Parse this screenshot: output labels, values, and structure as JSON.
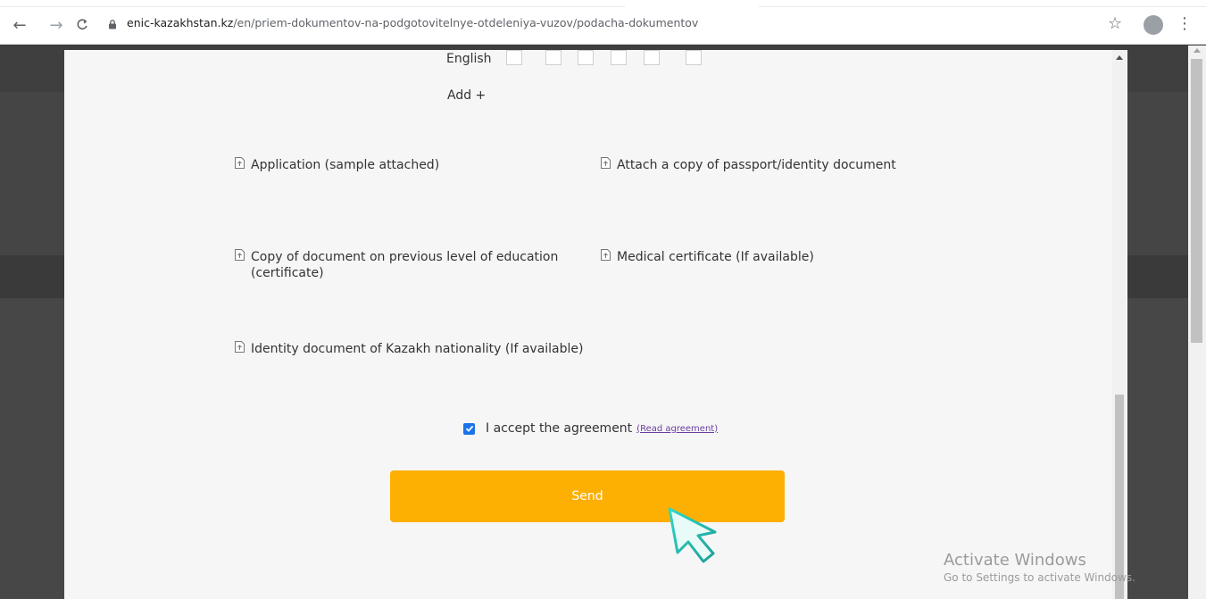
{
  "browser": {
    "url_host": "enic-kazakhstan.kz",
    "url_path": "/en/priem-dokumentov-na-podgotovitelnye-otdeleniya-vuzov/podacha-dokumentov"
  },
  "form": {
    "language_label": "English",
    "add_label": "Add +",
    "documents": [
      {
        "label": "Application (sample attached)"
      },
      {
        "label": "Attach a copy of passport/identity document"
      },
      {
        "label": "Copy of document on previous level of education (certificate)"
      },
      {
        "label": "Medical certificate (If available)"
      },
      {
        "label": "Identity document of Kazakh nationality (If available)"
      }
    ],
    "agreement": {
      "checked": true,
      "label": "I accept the agreement",
      "link_label": "(Read agreement)"
    },
    "send_label": "Send"
  },
  "watermark": {
    "title": "Activate Windows",
    "subtitle": "Go to Settings to activate Windows."
  },
  "colors": {
    "send_button": "#fdaf02",
    "checkbox": "#1a73e8",
    "link": "#6a3ea1"
  }
}
